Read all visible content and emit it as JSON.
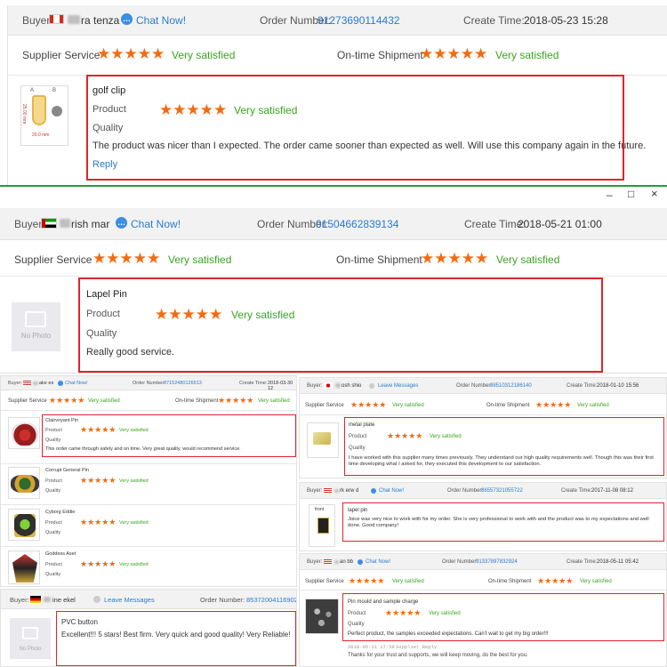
{
  "r1": {
    "buyer_label": "Buyer:",
    "buyer_name": "ra tenza",
    "chat": "Chat Now!",
    "order_label": "Order Number:",
    "order_no": "91273690114432",
    "time_label": "Create Time:",
    "time": "2018-05-23 15:28",
    "supplier_service": "Supplier Service",
    "ontime": "On-time Shipment",
    "satisfied": "Very satisfied",
    "product_title": "golf clip",
    "product_label": "Product",
    "quality_label": "Quality",
    "comment": "The product was nicer than I expected. The order came sooner than expected as well. Will use this company again in the future.",
    "reply": "Reply",
    "stars": "★★★★★",
    "thumb_a": "A",
    "thumb_b": "B",
    "thumb_dim1": "25.00 mm",
    "thumb_dim2": "20.0 mm"
  },
  "window_controls": {
    "min": "–",
    "max": "□",
    "close": "×"
  },
  "r2": {
    "buyer_label": "Buyer:",
    "buyer_name": "rish mar",
    "chat": "Chat Now!",
    "order_label": "Order Number:",
    "order_no": "91504662839134",
    "time_label": "Create Time:",
    "time": "2018-05-21 01:00",
    "supplier_service": "Supplier Service",
    "ontime": "On-time Shipment",
    "satisfied": "Very satisfied",
    "product_title": "Lapel Pin",
    "product_label": "Product",
    "quality_label": "Quality",
    "comment": "Really good service.",
    "no_photo": "No Photo",
    "stars": "★★★★★"
  },
  "r3": {
    "buyer_label": "Buyer:",
    "buyer_name": "ake es",
    "chat": "Chat Now!",
    "order_label": "Order Number:",
    "order_no": "87152480126513",
    "time_label": "Create Time:",
    "time": "2018-03-30 12",
    "supplier_service": "Supplier Service",
    "ontime": "On-time Shipment",
    "satisfied": "Very satisfied",
    "stars": "★★★★★",
    "items": [
      {
        "title": "Clairvoyant Pin",
        "product": "Product",
        "quality": "Quality",
        "comment": "This order came through safely and on time. Very great quality, would recommend service."
      },
      {
        "title": "Corrupt General Pin",
        "product": "Product",
        "quality": "Quality",
        "comment": ""
      },
      {
        "title": "Cyborg Eddie",
        "product": "Product",
        "quality": "Quality",
        "comment": ""
      },
      {
        "title": "Goddess Aset",
        "product": "Product",
        "quality": "Quality",
        "comment": ""
      }
    ]
  },
  "r4": {
    "buyer_label": "Buyer:",
    "buyer_name": "ine ekel",
    "leave": "Leave Messages",
    "order_label": "Order Number:",
    "order_no": "85372004116902",
    "product_title": "PVC button",
    "comment": "Excellent!!! 5 stars! Best firm. Very quick and good quality! Very Reliable!",
    "no_photo": "No Photo"
  },
  "r5": {
    "buyer_label": "Buyer:",
    "buyer_name": "osh shio",
    "leave": "Leave Messages",
    "order_label": "Order Number:",
    "order_no": "88510312186140",
    "time_label": "Create Time:",
    "time": "2018-01-10 15:56",
    "supplier_service": "Supplier Service",
    "ontime": "On-time Shipment",
    "satisfied": "Very satisfied",
    "stars": "★★★★★",
    "product_title": "metal plate",
    "product_label": "Product",
    "quality_label": "Quality",
    "comment": "I have worked with this supplier many times previously. They understand our high quality requirements well. Though this was their first time developing what I asked for, they executed this development to our satisfaction."
  },
  "r6": {
    "buyer_label": "Buyer:",
    "buyer_name": "rk erw d",
    "chat": "Chat Now!",
    "order_label": "Order Number:",
    "order_no": "86557321055722",
    "time_label": "Create Time:",
    "time": "2017-11-08 08:12",
    "product_title": "lapel pin",
    "comment": "Joice was very nice to work with for my order. She is very professional to work with and the product was to my expectations and well done. Good company!",
    "thumb_label": "front"
  },
  "r7": {
    "buyer_label": "Buyer:",
    "buyer_name": "an bb",
    "chat": "Chat Now!",
    "order_label": "Order Number:",
    "order_no": "91337897832924",
    "time_label": "Create Time:",
    "time": "2018-05-11 05:42",
    "supplier_service": "Supplier Service",
    "ontime": "On-time Shipment",
    "satisfied": "Very satisfied",
    "stars": "★★★★★",
    "product_title": "Pin mould and sample charge",
    "product_label": "Product",
    "quality_label": "Quality",
    "comment": "Perfect product, the samples exceeded expectations. Can't wait to get my big order!!!",
    "supplier_reply_time": "2018-05-11 17:58",
    "supplier_reply_label": "Supplier Reply",
    "supplier_reply": "Thanks for your trust and supports, we will keep moving, do the best for you."
  },
  "colors": {
    "accent": "#2a7bd0",
    "star": "#f26b10",
    "satisfied": "#3aa51f",
    "highlight": "#e0242c",
    "header_bg": "#f2f2f2"
  }
}
